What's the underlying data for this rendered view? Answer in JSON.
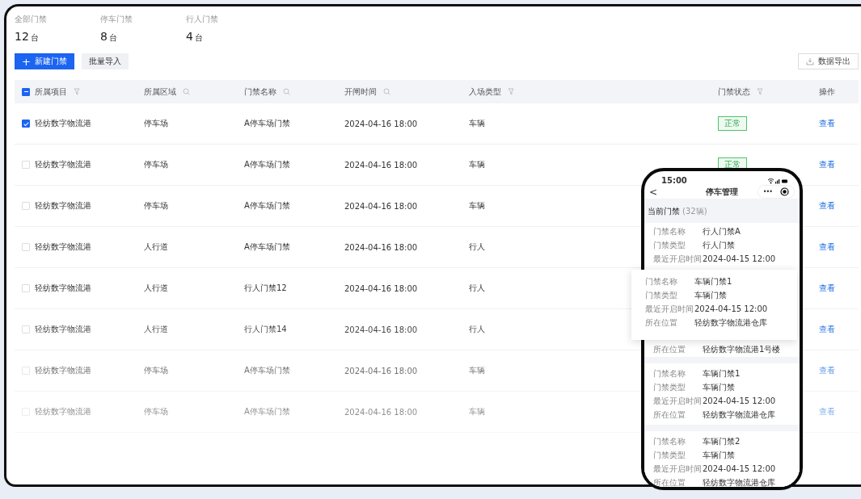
{
  "stats": [
    {
      "label": "全部门禁",
      "value": "12",
      "unit": "台"
    },
    {
      "label": "停车门禁",
      "value": "8",
      "unit": "台"
    },
    {
      "label": "行人门禁",
      "value": "4",
      "unit": "台"
    }
  ],
  "actions": {
    "primary": {
      "icon": "+",
      "label": "新建门禁"
    },
    "secondary": {
      "label": "批量导入"
    },
    "export": {
      "label": "数据导出"
    }
  },
  "table": {
    "header_checkbox": {
      "partial": true
    },
    "columns": [
      {
        "label": "所属项目",
        "kind": "filter"
      },
      {
        "label": "所属区域",
        "kind": "search"
      },
      {
        "label": "门禁名称",
        "kind": "search"
      },
      {
        "label": "开闸时间",
        "kind": "search"
      },
      {
        "label": "入场类型",
        "kind": "filter"
      },
      {
        "label": "门禁状态",
        "kind": "filter"
      },
      {
        "label": "操作",
        "kind": "plain"
      }
    ],
    "rows": [
      {
        "checked": true,
        "cells": [
          "轻纺数字物流港",
          "停车场",
          "A停车场门禁",
          "2024-04-16 18:00",
          "车辆"
        ],
        "status": "正常",
        "action": "查看"
      },
      {
        "checked": false,
        "cells": [
          "轻纺数字物流港",
          "停车场",
          "A停车场门禁",
          "2024-04-16 18:00",
          "车辆"
        ],
        "status": "正常",
        "action": "查看"
      },
      {
        "checked": false,
        "cells": [
          "轻纺数字物流港",
          "停车场",
          "A停车场门禁",
          "2024-04-16 18:00",
          "车辆"
        ],
        "action": "查看"
      },
      {
        "checked": false,
        "cells": [
          "轻纺数字物流港",
          "人行道",
          "A停车场门禁",
          "2024-04-16 18:00",
          "行人"
        ],
        "action": "查看"
      },
      {
        "checked": false,
        "cells": [
          "轻纺数字物流港",
          "人行道",
          "行人门禁12",
          "2024-04-16 18:00",
          "行人"
        ],
        "action": "查看"
      },
      {
        "checked": false,
        "cells": [
          "轻纺数字物流港",
          "人行道",
          "行人门禁14",
          "2024-04-16 18:00",
          "行人"
        ],
        "action": "查看"
      },
      {
        "checked": false,
        "cells": [
          "轻纺数字物流港",
          "停车场",
          "A停车场门禁",
          "2024-04-16 18:00",
          "车辆"
        ],
        "action": "查看"
      },
      {
        "checked": false,
        "cells": [
          "轻纺数字物流港",
          "停车场",
          "A停车场门禁",
          "2024-04-16 18:00",
          "车辆"
        ],
        "action": "查看"
      }
    ]
  },
  "phone": {
    "time": "15:00",
    "title": "停车管理",
    "back": "<",
    "menu": "•••",
    "section": {
      "title": "当前门禁",
      "count": "(32辆)"
    },
    "cards": [
      {
        "fields": [
          {
            "label": "门禁名称",
            "value": "行人门禁A"
          },
          {
            "label": "门禁类型",
            "value": "行人门禁"
          },
          {
            "label": "最近开启时间",
            "value": "2024-04-15 12:00"
          },
          {
            "label": "所在位置",
            "value": "轻纺数字物流港1号楼"
          }
        ]
      },
      {
        "fields": [
          {
            "label": "门禁名称",
            "value": "车辆门禁1"
          },
          {
            "label": "门禁类型",
            "value": "车辆门禁"
          },
          {
            "label": "最近开启时间",
            "value": "2024-04-15 12:00"
          },
          {
            "label": "所在位置",
            "value": "轻纺数字物流港仓库"
          }
        ]
      },
      {
        "fields": [
          {
            "label": "门禁名称",
            "value": "车辆门禁2"
          },
          {
            "label": "门禁类型",
            "value": "车辆门禁"
          },
          {
            "label": "最近开启时间",
            "value": "2024-04-15 12:00"
          },
          {
            "label": "所在位置",
            "value": "轻纺数字物流港仓库"
          }
        ]
      }
    ]
  },
  "popup_card": {
    "fields": [
      {
        "label": "门禁名称",
        "value": "车辆门禁1"
      },
      {
        "label": "门禁类型",
        "value": "车辆门禁"
      },
      {
        "label": "最近开启时间",
        "value": "2024-04-15 12:00"
      },
      {
        "label": "所在位置",
        "value": "轻纺数字物流港仓库"
      }
    ]
  }
}
